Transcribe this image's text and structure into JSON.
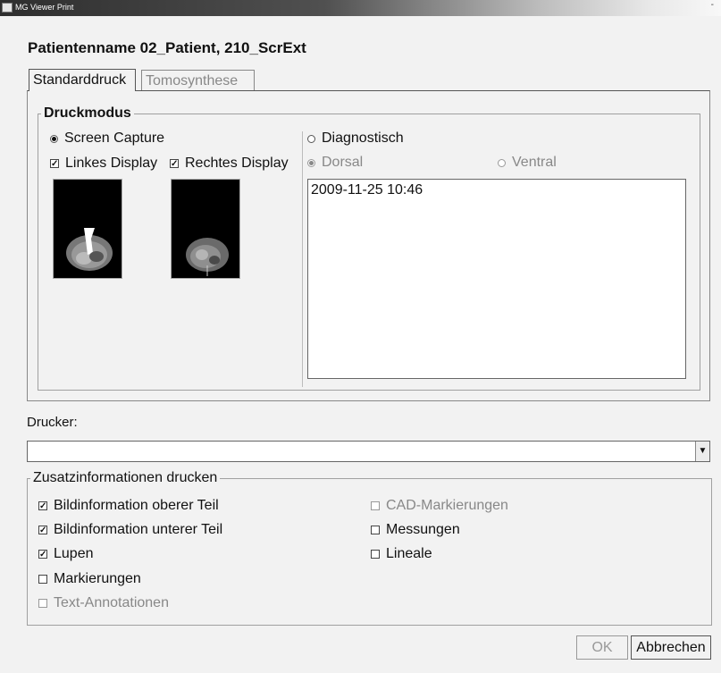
{
  "window": {
    "title": "MG Viewer Print"
  },
  "header": {
    "patient_title": "Patientenname 02_Patient, 210_ScrExt"
  },
  "tabs": [
    {
      "label": "Standarddruck",
      "active": true
    },
    {
      "label": "Tomosynthese",
      "active": false
    }
  ],
  "druckmodus": {
    "legend": "Druckmodus",
    "screen_capture": {
      "label": "Screen Capture",
      "selected": true
    },
    "linkes_display": {
      "label": "Linkes Display",
      "checked": true
    },
    "rechtes_display": {
      "label": "Rechtes Display",
      "checked": true
    },
    "diagnostisch": {
      "label": "Diagnostisch",
      "selected": false
    },
    "dorsal": {
      "label": "Dorsal",
      "selected": true,
      "enabled": false
    },
    "ventral": {
      "label": "Ventral",
      "selected": false,
      "enabled": false
    },
    "list_items": [
      "2009-11-25 10:46"
    ]
  },
  "printer": {
    "label": "Drucker:",
    "value": ""
  },
  "zusatz": {
    "legend": "Zusatzinformationen drucken",
    "left": [
      {
        "label": "Bildinformation oberer Teil",
        "checked": true,
        "enabled": true
      },
      {
        "label": "Bildinformation unterer Teil",
        "checked": true,
        "enabled": true
      },
      {
        "label": "Lupen",
        "checked": true,
        "enabled": true
      },
      {
        "label": "Markierungen",
        "checked": false,
        "enabled": true
      },
      {
        "label": "Text-Annotationen",
        "checked": false,
        "enabled": false
      }
    ],
    "right": [
      {
        "label": "CAD-Markierungen",
        "checked": false,
        "enabled": false
      },
      {
        "label": "Messungen",
        "checked": false,
        "enabled": true
      },
      {
        "label": "Lineale",
        "checked": false,
        "enabled": true
      }
    ]
  },
  "buttons": {
    "ok": "OK",
    "cancel": "Abbrechen"
  },
  "colors": {
    "background": "#f2f2f2",
    "disabled_text": "#888888",
    "text": "#111111"
  },
  "icons": {
    "checkbox_checked": "check-mark",
    "dropdown": "triangle-down"
  }
}
